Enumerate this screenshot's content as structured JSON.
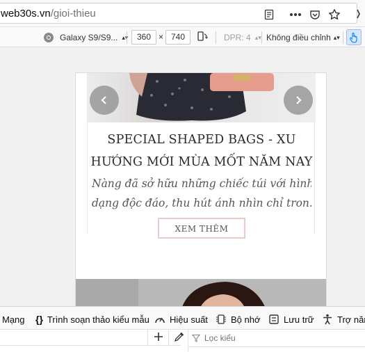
{
  "urlbar": {
    "domain": "web30s.vn",
    "path": "/gioi-thieu",
    "icons": [
      "reader-mode-icon",
      "more-icon",
      "pocket-icon",
      "bookmark-star-icon"
    ]
  },
  "rdm": {
    "device": "Galaxy S9/S9...",
    "width": "360",
    "times": "×",
    "height": "740",
    "dpr": "DPR: 4",
    "throttle": "Không điều chỉnh"
  },
  "slide": {
    "title_line1": "SPECIAL SHAPED BAGS - XU",
    "title_line2": "HƯỚNG MỚI MÙA MỐT NĂM NAY",
    "desc_line1": "Nàng đã sở hữu những chiếc túi với hình",
    "desc_line2": "dạng độc đáo, thu hút ánh nhìn chỉ tron...",
    "button": "XEM THÊM"
  },
  "devtools": {
    "tabs": [
      {
        "label": "Mạng",
        "icon": ""
      },
      {
        "label": "Trình soạn thảo kiểu mẫu",
        "icon": "braces-icon"
      },
      {
        "label": "Hiệu suất",
        "icon": "gauge-icon"
      },
      {
        "label": "Bộ nhớ",
        "icon": "memory-icon"
      },
      {
        "label": "Lưu trữ",
        "icon": "storage-icon"
      },
      {
        "label": "Trợ năn",
        "icon": "accessibility-icon"
      }
    ],
    "filter_placeholder": "Lọc kiểu"
  },
  "colors": {
    "accent_blue": "#0a84ff",
    "button_border": "#f0c8c8"
  }
}
